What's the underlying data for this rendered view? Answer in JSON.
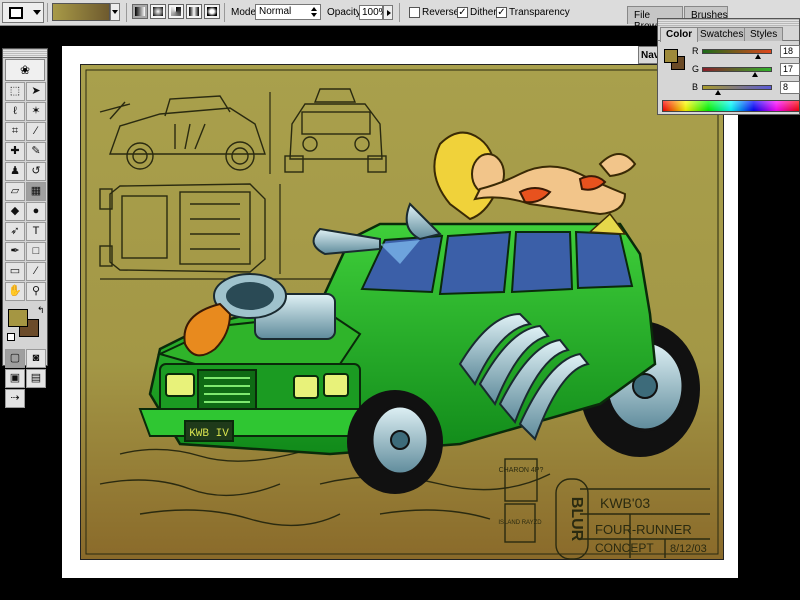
{
  "options_bar": {
    "mode_label": "Mode:",
    "mode_value": "Normal",
    "opacity_label": "Opacity:",
    "opacity_value": "100%",
    "reverse_label": "Reverse",
    "reverse_checked": false,
    "dither_label": "Dither",
    "dither_checked": true,
    "transparency_label": "Transparency",
    "transparency_checked": true,
    "gradient_colors": [
      "#a89a47",
      "#6e5a2e"
    ]
  },
  "palette_well": {
    "tabs": [
      "File Browser",
      "Brushes"
    ]
  },
  "navigator": {
    "tab_label": "Nav"
  },
  "color_palette": {
    "tabs": [
      "Color",
      "Swatches",
      "Styles"
    ],
    "active_tab": "Color",
    "foreground_color": "#9e8a3a",
    "background_color": "#6a4a26",
    "channels": [
      {
        "label": "R",
        "value": "18"
      },
      {
        "label": "G",
        "value": "17"
      },
      {
        "label": "B",
        "value": "8"
      }
    ]
  },
  "toolbox": {
    "foreground_color": "#a59642",
    "background_color": "#6b4b2a"
  },
  "canvas": {
    "background_color": "#a39746",
    "signature": "KWB'03",
    "caption_line1": "FOUR-RUNNER",
    "caption_line2": "CONCEPT",
    "date": "8/12/03",
    "vertical_logo": "BLUR",
    "license_plate": "KWB IV",
    "stamp_text": "CHARON 4P?",
    "stamp_text2": "ISLAND RAYZD"
  }
}
